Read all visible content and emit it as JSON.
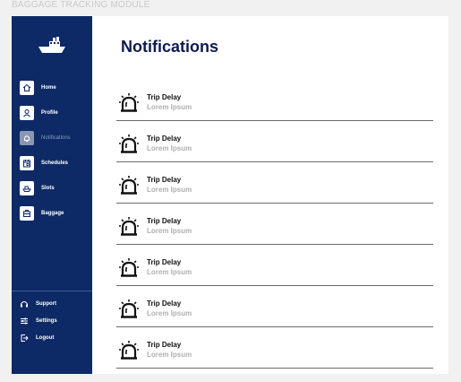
{
  "module_label": "BAGGAGE TRACKING MODULE",
  "sidebar": {
    "logo_icon": "ship-icon",
    "items": [
      {
        "label": "Home",
        "icon": "home-icon",
        "active": false
      },
      {
        "label": "Profile",
        "icon": "user-icon",
        "active": false
      },
      {
        "label": "Notifications",
        "icon": "bell-icon",
        "active": true
      },
      {
        "label": "Schedules",
        "icon": "calendar-icon",
        "active": false
      },
      {
        "label": "Slots",
        "icon": "boat-icon",
        "active": false
      },
      {
        "label": "Baggage",
        "icon": "luggage-icon",
        "active": false
      }
    ],
    "bottom": [
      {
        "label": "Support",
        "icon": "headset-icon"
      },
      {
        "label": "Settings",
        "icon": "sliders-icon"
      },
      {
        "label": "Logout",
        "icon": "logout-icon"
      }
    ]
  },
  "main": {
    "title": "Notifications",
    "notifications": [
      {
        "title": "Trip Delay",
        "subtitle": "Lorem Ipsum",
        "icon": "alarm-bell-icon"
      },
      {
        "title": "Trip Delay",
        "subtitle": "Lorem Ipsum",
        "icon": "alarm-bell-icon"
      },
      {
        "title": "Trip Delay",
        "subtitle": "Lorem Ipsum",
        "icon": "alarm-bell-icon"
      },
      {
        "title": "Trip Delay",
        "subtitle": "Lorem Ipsum",
        "icon": "alarm-bell-icon"
      },
      {
        "title": "Trip Delay",
        "subtitle": "Lorem Ipsum",
        "icon": "alarm-bell-icon"
      },
      {
        "title": "Trip Delay",
        "subtitle": "Lorem Ipsum",
        "icon": "alarm-bell-icon"
      },
      {
        "title": "Trip Delay",
        "subtitle": "Lorem Ipsum",
        "icon": "alarm-bell-icon"
      }
    ]
  },
  "colors": {
    "sidebar": "#0d2a66",
    "title": "#0d1a52",
    "background": "#f1f1f1"
  }
}
